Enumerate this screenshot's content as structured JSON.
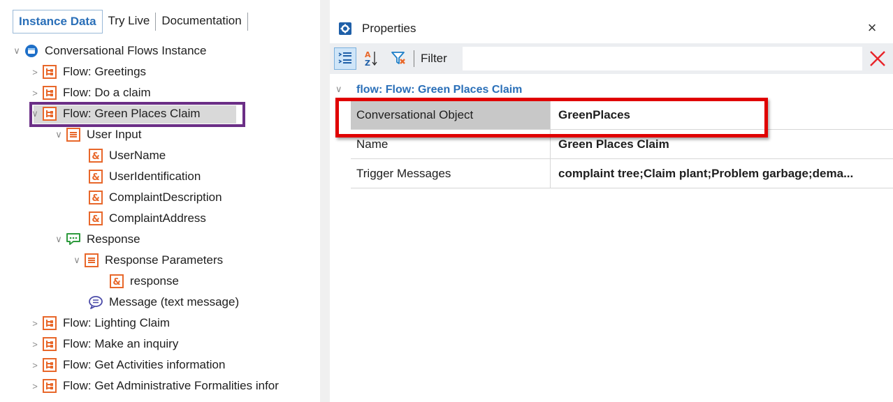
{
  "tabs": [
    {
      "label": "Instance Data",
      "active": true
    },
    {
      "label": "Try Live",
      "active": false
    },
    {
      "label": "Documentation",
      "active": false
    }
  ],
  "tree": {
    "root": "Conversational Flows Instance",
    "flows_before": [
      "Flow: Greetings",
      "Flow: Do a claim"
    ],
    "selected_flow": "Flow: Green Places Claim",
    "user_input": {
      "label": "User Input",
      "vars": [
        "UserName",
        "UserIdentification",
        "ComplaintDescription",
        "ComplaintAddress"
      ]
    },
    "response": {
      "label": "Response",
      "params_label": "Response Parameters",
      "param_var": "response",
      "message": "Message (text message)"
    },
    "flows_after": [
      "Flow: Lighting Claim",
      "Flow: Make an inquiry",
      "Flow: Get Activities information",
      "Flow: Get Administrative Formalities infor"
    ]
  },
  "properties": {
    "title": "Properties",
    "close_glyph": "×",
    "filter_label": "Filter",
    "filter_value": "",
    "filter_placeholder": "",
    "category": "flow: Flow: Green Places Claim",
    "rows": [
      {
        "name": "Conversational Object",
        "value": "GreenPlaces"
      },
      {
        "name": "Name",
        "value": "Green Places Claim"
      },
      {
        "name": "Trigger Messages",
        "value": "complaint tree;Claim plant;Problem garbage;dema..."
      }
    ]
  },
  "colors": {
    "accent_blue": "#2a6fb8",
    "highlight_purple": "#6b2f86",
    "highlight_red": "#e00000",
    "icon_orange": "#e8672a",
    "icon_green": "#2e9b3e"
  },
  "icons": {
    "root": "instance-icon",
    "flow": "flow-icon",
    "group": "parameters-icon",
    "variable": "variable-icon",
    "response": "response-bubble-icon",
    "message": "message-icon",
    "categorized": "categorized-view-icon",
    "alphabetical": "sort-alphabetical-icon",
    "filter": "filter-icon",
    "clear": "clear-filter-icon",
    "settings": "properties-gear-icon"
  }
}
